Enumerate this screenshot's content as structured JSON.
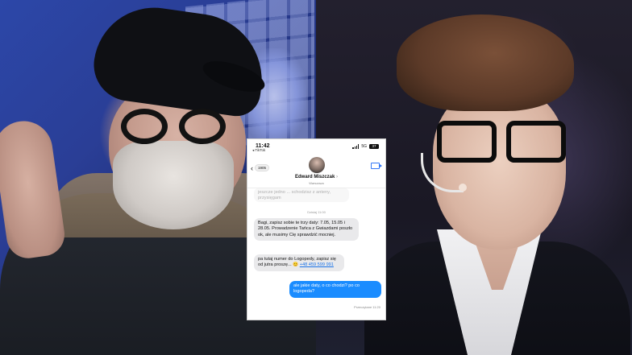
{
  "phone": {
    "status": {
      "time": "11:42",
      "app_source": "◂ TikTok",
      "network": "5G",
      "battery": "37"
    },
    "header": {
      "back_badge": "1905",
      "contact_name": "Edward Miszczak",
      "contact_chevron": "›",
      "contact_subtitle": "Warszawa"
    },
    "faded_message": "jeszcze jedno ... schodzisz z anteny, przysięgam",
    "date_stamp": "Dzisiaj 11:00",
    "messages": [
      {
        "direction": "in",
        "text": "Bagi, zapisz sobie te trzy daty: 7.05, 15.05 i 28.05. Prowadzenie Tańca z Gwiazdami poszło ok, ale musimy Cię sprawdzić mocniej."
      },
      {
        "direction": "in",
        "text": "pa tutaj numer do Logopedy, zapisz się od jutra proszę... 😊",
        "link": "+48 459 599 991"
      },
      {
        "direction": "out",
        "text": "ale jakie daty, o co chodzi? po co logopeda?"
      }
    ],
    "delivered": "Przeczytane 11:20"
  },
  "colors": {
    "outgoing_bubble": "#1a8cff",
    "incoming_bubble": "#e9e9eb",
    "link": "#1a73e8"
  }
}
